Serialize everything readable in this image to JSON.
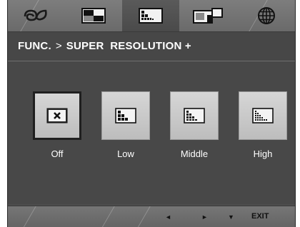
{
  "tabs": [
    {
      "name": "picture-mode-icon"
    },
    {
      "name": "color-settings-icon"
    },
    {
      "name": "function-icon",
      "active": true
    },
    {
      "name": "pip-icon"
    },
    {
      "name": "language-icon"
    }
  ],
  "header": {
    "section": "FUNC.",
    "separator": ">",
    "page": "SUPER  RESOLUTION +"
  },
  "options": [
    {
      "label": "Off",
      "selected": true,
      "icon": "off-icon"
    },
    {
      "label": "Low",
      "selected": false,
      "icon": "sr-low-icon"
    },
    {
      "label": "Middle",
      "selected": false,
      "icon": "sr-middle-icon"
    },
    {
      "label": "High",
      "selected": false,
      "icon": "sr-high-icon"
    }
  ],
  "footer": {
    "left": "◄",
    "right": "►",
    "down": "▼",
    "exit": "EXIT"
  }
}
